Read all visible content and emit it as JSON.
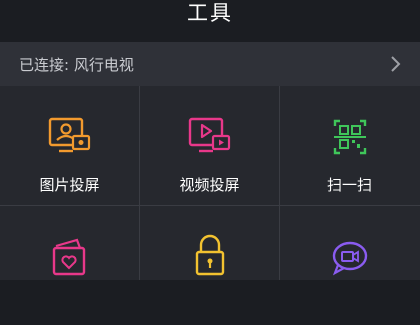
{
  "header": {
    "title": "工具"
  },
  "connection": {
    "label": "已连接: 风行电视"
  },
  "tools": [
    {
      "label": "图片投屏",
      "icon": "image-cast-icon",
      "color": "#f29a2e"
    },
    {
      "label": "视频投屏",
      "icon": "video-cast-icon",
      "color": "#e8388a"
    },
    {
      "label": "扫一扫",
      "icon": "qr-scan-icon",
      "color": "#3fc65a"
    },
    {
      "label": "",
      "icon": "heart-card-icon",
      "color": "#e8388a"
    },
    {
      "label": "",
      "icon": "lock-icon",
      "color": "#f2c230"
    },
    {
      "label": "",
      "icon": "chat-video-icon",
      "color": "#8a5cf0"
    }
  ]
}
